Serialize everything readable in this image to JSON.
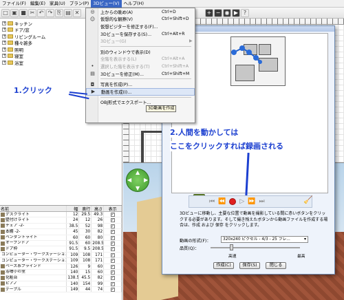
{
  "menubar": {
    "items": [
      "ファイル(F)",
      "編集(E)",
      "家具(U)",
      "プラン(P)",
      "3Dビュー(V)",
      "ヘルプ(H)"
    ],
    "active_index": 4
  },
  "tree": {
    "items": [
      "キッチン",
      "ドア/窓",
      "リビングルーム",
      "種々雑多",
      "照明",
      "寝室",
      "浴室"
    ]
  },
  "furniture_table": {
    "headers": [
      "名前",
      "幅",
      "奥行",
      "高さ",
      "表示"
    ],
    "rows": [
      [
        "デスクライト",
        "12",
        "29.5",
        "49.3"
      ],
      [
        "壁付けライト",
        "24",
        "12",
        "26"
      ],
      [
        "チェア -2-",
        "38.5",
        "52",
        "98"
      ],
      [
        "本棚 -2-",
        "45",
        "30",
        "82"
      ],
      [
        "ペンダントライト",
        "60",
        "60",
        "80"
      ],
      [
        "オープンドア",
        "91.5",
        "60",
        "208.5"
      ],
      [
        "ドア枠",
        "91.5",
        "9.5",
        "208.5"
      ],
      [
        "コンピューター・ワークステーション",
        "109",
        "108",
        "171"
      ],
      [
        "コンピューター・ワークステーション",
        "109",
        "108",
        "171"
      ],
      [
        "ベース系プラインド",
        "126",
        "9",
        "60"
      ],
      [
        "浴槽小の室",
        "140",
        "15",
        "60"
      ],
      [
        "化粧台",
        "138.5",
        "45.5",
        "82"
      ],
      [
        "ピアノ",
        "140",
        "154",
        "99"
      ],
      [
        "テーブル",
        "149",
        "44",
        "74"
      ]
    ]
  },
  "menu": {
    "items": [
      {
        "label": "上からの眺め(A)",
        "shortcut": "Ctrl+D",
        "disabled": false
      },
      {
        "label": "仮想的な観察(V)",
        "shortcut": "Ctrl+Shift+D",
        "disabled": false
      },
      {
        "label": "仮想ビジターを修正する(F)...",
        "shortcut": "",
        "disabled": false
      },
      {
        "label": "3Dビューを保存する(S)...",
        "shortcut": "Ctrl+Alt+R",
        "disabled": false
      },
      {
        "label": "3Dビュー(G)",
        "shortcut": "",
        "disabled": true
      },
      {
        "label": "別のウィンドウで表示(D)",
        "shortcut": "",
        "disabled": false
      },
      {
        "label": "全階を表示する(L)",
        "shortcut": "Ctrl+Alt+A",
        "disabled": true
      },
      {
        "label": "選択した階を表示する(T)",
        "shortcut": "Ctrl+Shift+A",
        "disabled": true
      },
      {
        "label": "3Dビューを修正(M)...",
        "shortcut": "Ctrl+Shift+M",
        "disabled": false
      },
      {
        "label": "写真を作成(P)...",
        "shortcut": "",
        "disabled": false
      },
      {
        "label": "動画を作成(I)...",
        "shortcut": "",
        "disabled": false
      },
      {
        "label": "OBJ形式でエクスポート...",
        "shortcut": "",
        "disabled": false
      }
    ],
    "tooltip": "3D動画を作成"
  },
  "dialog": {
    "description": "3Dビューに移動し、主要な位置で動画を撮影している間に赤いボタンをクリックする必要があります。そして撮き残えたボタンから動画ファイルを作成する場合は、作成 および 保存 をクリックします。",
    "format_label": "動画の形式(F)：",
    "format_value": "320x240 ピクセル - 4/3 - 25 フレ...",
    "quality_label": "品質(Q)：",
    "quality_low": "高速",
    "quality_high": "最高",
    "buttons": [
      "作成(C)",
      "保存(S)",
      "閉じる"
    ]
  },
  "annotations": {
    "step1": "1.クリック",
    "step2_line1": "2.人間を動かしては",
    "step2_line2": "ここをクリックすれば録画される"
  },
  "colors": {
    "annotation_blue": "#1b3fd0",
    "record_red": "#e02020",
    "menu_highlight": "#dde7f7"
  }
}
